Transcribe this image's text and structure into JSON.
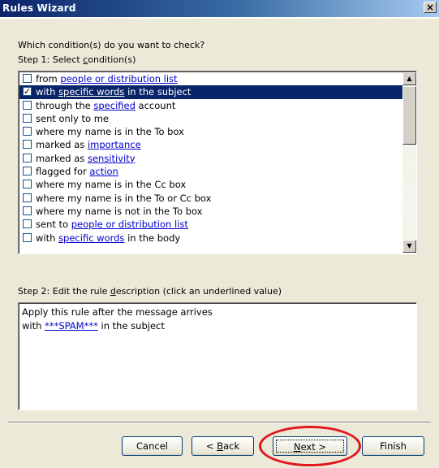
{
  "window": {
    "title": "Rules Wizard",
    "close_glyph": "×"
  },
  "header": {
    "question": "Which condition(s) do you want to check?",
    "step1_prefix": "Step 1: Select ",
    "step1_accel": "c",
    "step1_suffix": "ondition(s)"
  },
  "conditions": [
    {
      "parts": [
        "from ",
        "people or distribution list",
        ""
      ],
      "link": true,
      "checked": false,
      "selected": false
    },
    {
      "parts": [
        "with ",
        "specific words",
        " in the subject"
      ],
      "link": true,
      "checked": true,
      "selected": true
    },
    {
      "parts": [
        "through the ",
        "specified",
        " account"
      ],
      "link": true,
      "checked": false,
      "selected": false
    },
    {
      "parts": [
        "sent only to me",
        "",
        ""
      ],
      "link": false,
      "checked": false,
      "selected": false
    },
    {
      "parts": [
        "where my name is in the To box",
        "",
        ""
      ],
      "link": false,
      "checked": false,
      "selected": false
    },
    {
      "parts": [
        "marked as ",
        "importance",
        ""
      ],
      "link": true,
      "checked": false,
      "selected": false
    },
    {
      "parts": [
        "marked as ",
        "sensitivity",
        ""
      ],
      "link": true,
      "checked": false,
      "selected": false
    },
    {
      "parts": [
        "flagged for ",
        "action",
        ""
      ],
      "link": true,
      "checked": false,
      "selected": false
    },
    {
      "parts": [
        "where my name is in the Cc box",
        "",
        ""
      ],
      "link": false,
      "checked": false,
      "selected": false
    },
    {
      "parts": [
        "where my name is in the To or Cc box",
        "",
        ""
      ],
      "link": false,
      "checked": false,
      "selected": false
    },
    {
      "parts": [
        "where my name is not in the To box",
        "",
        ""
      ],
      "link": false,
      "checked": false,
      "selected": false
    },
    {
      "parts": [
        "sent to ",
        "people or distribution list",
        ""
      ],
      "link": true,
      "checked": false,
      "selected": false
    },
    {
      "parts": [
        "with ",
        "specific words",
        " in the body"
      ],
      "link": true,
      "checked": false,
      "selected": false
    }
  ],
  "step2": {
    "prefix": "Step 2: Edit the rule ",
    "accel": "d",
    "suffix": "escription (click an underlined value)"
  },
  "description": {
    "line1": "Apply this rule after the message arrives",
    "line2_prefix": "with ",
    "line2_link": "***SPAM***",
    "line2_suffix": " in the subject"
  },
  "buttons": {
    "cancel": "Cancel",
    "back_prefix": "< ",
    "back_accel": "B",
    "back_suffix": "ack",
    "next_accel": "N",
    "next_suffix": "ext >",
    "finish": "Finish"
  },
  "scroll_arrows": {
    "up": "▲",
    "down": "▼"
  },
  "colors": {
    "title_bar": "#0a246a",
    "selection": "#0a246a",
    "link": "#0000cc",
    "highlight_circle": "#e3141c",
    "dialog_bg": "#ece9d8"
  }
}
